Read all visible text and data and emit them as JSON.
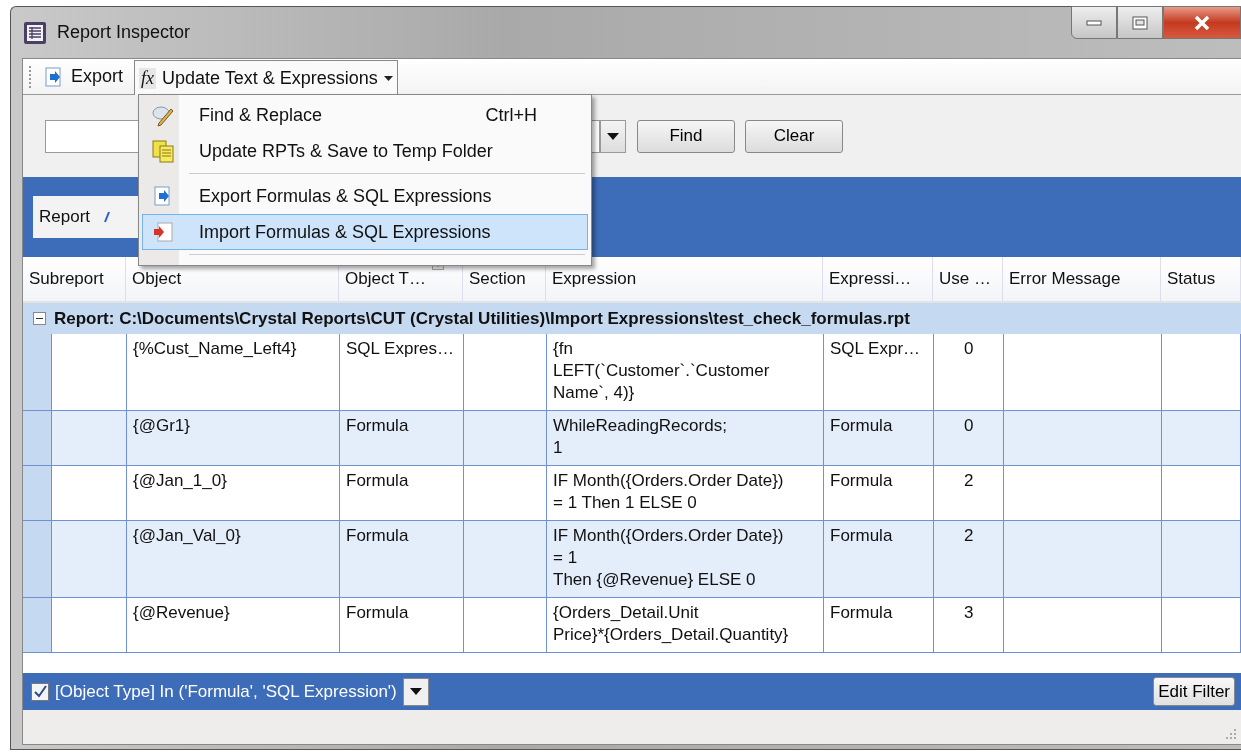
{
  "window": {
    "title": "Report Inspector"
  },
  "toolbar": {
    "export_button": "Export",
    "update_menu": {
      "icon_text": "fx",
      "label": "Update Text & Expressions",
      "expanded": true
    }
  },
  "menu": [
    {
      "kind": "item",
      "label": "Find & Replace",
      "shortcut": "Ctrl+H",
      "selected": false
    },
    {
      "kind": "item",
      "label": "Update RPTs & Save to Temp Folder",
      "selected": false
    },
    {
      "kind": "separator"
    },
    {
      "kind": "item",
      "label": "Export Formulas & SQL Expressions",
      "selected": false
    },
    {
      "kind": "item",
      "label": "Import Formulas & SQL Expressions",
      "selected": true
    },
    {
      "kind": "separator"
    }
  ],
  "search": {
    "find_button": "Find",
    "clear_button": "Clear"
  },
  "group_panel": {
    "label": "Report"
  },
  "table": {
    "columns": [
      {
        "label": "Subreport"
      },
      {
        "label": "Object"
      },
      {
        "label": "Object T…",
        "filter": true
      },
      {
        "label": "Section"
      },
      {
        "label": "Expression"
      },
      {
        "label": "Expressi…"
      },
      {
        "label": "Use …"
      },
      {
        "label": "Error Message"
      },
      {
        "label": "Status"
      }
    ],
    "group": {
      "label": "Report: C:\\Documents\\Crystal Reports\\CUT (Crystal Utilities)\\Import Expressions\\test_check_formulas.rpt",
      "expanded": true
    },
    "rows": [
      {
        "cells": [
          "",
          "{%Cust_Name_Left4}",
          "SQL Expres…",
          "",
          "{fn\nLEFT(`Customer`.`Customer\nName`, 4)}",
          "SQL Expr…",
          "0",
          "",
          ""
        ]
      },
      {
        "cells": [
          "",
          "{@Gr1}",
          "Formula",
          "",
          "WhileReadingRecords;\n1",
          "Formula",
          "0",
          "",
          ""
        ]
      },
      {
        "cells": [
          "",
          "{@Jan_1_0}",
          "Formula",
          "",
          "IF Month({Orders.Order Date})\n= 1 Then 1 ELSE 0",
          "Formula",
          "2",
          "",
          ""
        ]
      },
      {
        "cells": [
          "",
          "{@Jan_Val_0}",
          "Formula",
          "",
          "IF Month({Orders.Order Date})\n= 1\nThen {@Revenue} ELSE 0",
          "Formula",
          "2",
          "",
          ""
        ]
      },
      {
        "cells": [
          "",
          "{@Revenue}",
          "Formula",
          "",
          "{Orders_Detail.Unit\nPrice}*{Orders_Detail.Quantity}",
          "Formula",
          "3",
          "",
          ""
        ]
      }
    ]
  },
  "filter": {
    "checked": true,
    "text": "[Object Type] In ('Formula', 'SQL Expression')",
    "edit_button": "Edit Filter"
  }
}
